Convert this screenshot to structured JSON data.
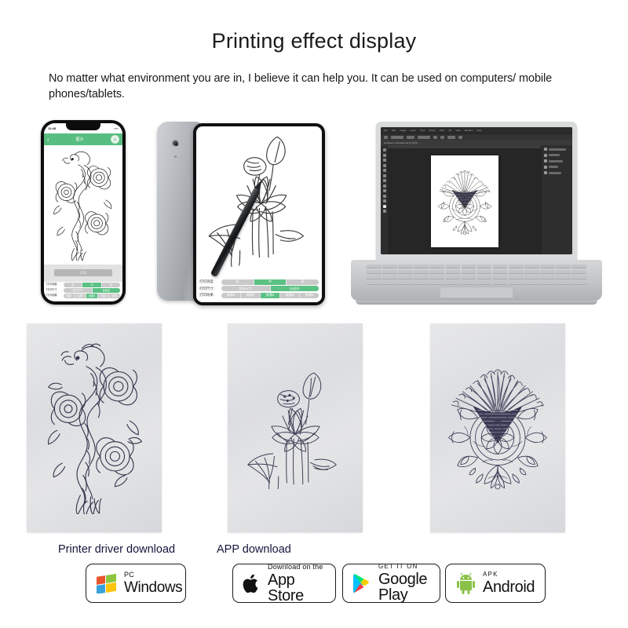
{
  "header": {
    "title": "Printing effect display",
    "subtitle": "No matter what environment you are in, I believe it can help you. It can be used on computers/ mobile phones/tablets."
  },
  "devices": {
    "phone": {
      "name": "smartphone-mockup",
      "status_time": "11:48",
      "status_icons": "▪▪▪",
      "appbar": {
        "back_icon": "‹",
        "title": "图片",
        "avatar_icon": "◎"
      },
      "action_button_label": "打印",
      "controls": [
        {
          "label": "打印浓度",
          "options": [
            "低",
            "中",
            "高"
          ],
          "selected": 1
        },
        {
          "label": "打印尺寸",
          "options": [
            "实际尺寸",
            "自适应"
          ],
          "selected": 1
        },
        {
          "label": "打印效果",
          "options": [
            "效果1",
            "效果2",
            "效果3",
            "效果4",
            "效果5"
          ],
          "selected": 2
        }
      ]
    },
    "tablet": {
      "name": "tablet-mockup",
      "controls": [
        {
          "label": "打印浓度:",
          "options": [
            "低",
            "中",
            "高"
          ],
          "selected": 1
        },
        {
          "label": "打印尺寸:",
          "options": [
            "实际尺寸",
            "自适应"
          ],
          "selected": 1
        },
        {
          "label": "打印效果:",
          "options": [
            "效果1",
            "效果2",
            "效果3",
            "效果4",
            "效果5"
          ],
          "selected": 2
        }
      ]
    },
    "laptop": {
      "name": "laptop-mockup",
      "editor_menus": [
        "File",
        "Edit",
        "Image",
        "Layer",
        "Type",
        "Select",
        "Filter",
        "3D",
        "View",
        "Window",
        "Help"
      ],
      "document_tab": "sunflower-mandala.psd @ 100%"
    }
  },
  "samples": [
    {
      "name": "printed-sample-dragon",
      "artwork": "dragon-and-peony-tattoo"
    },
    {
      "name": "printed-sample-lotus",
      "artwork": "lotus-flower-tattoo"
    },
    {
      "name": "printed-sample-sunflower",
      "artwork": "sunflower-mandala-tattoo"
    }
  ],
  "downloads": {
    "driver_label": "Printer driver download",
    "app_label": "APP download",
    "badges": [
      {
        "name": "windows-download-badge",
        "top": "PC",
        "main": "Windows",
        "icon": "windows-logo-icon"
      },
      {
        "name": "app-store-badge",
        "top": "Download on the",
        "main": "App Store",
        "icon": "apple-logo-icon"
      },
      {
        "name": "google-play-badge",
        "top": "GET IT ON",
        "main": "Google Play",
        "icon": "google-play-icon"
      },
      {
        "name": "android-apk-badge",
        "top": "APK",
        "main": "Android",
        "icon": "android-robot-icon"
      }
    ]
  },
  "colors": {
    "accent_green": "#58bd80",
    "label_navy": "#14143c",
    "editor_bg": "#262626",
    "paper_gray": "#e2e3e6"
  }
}
